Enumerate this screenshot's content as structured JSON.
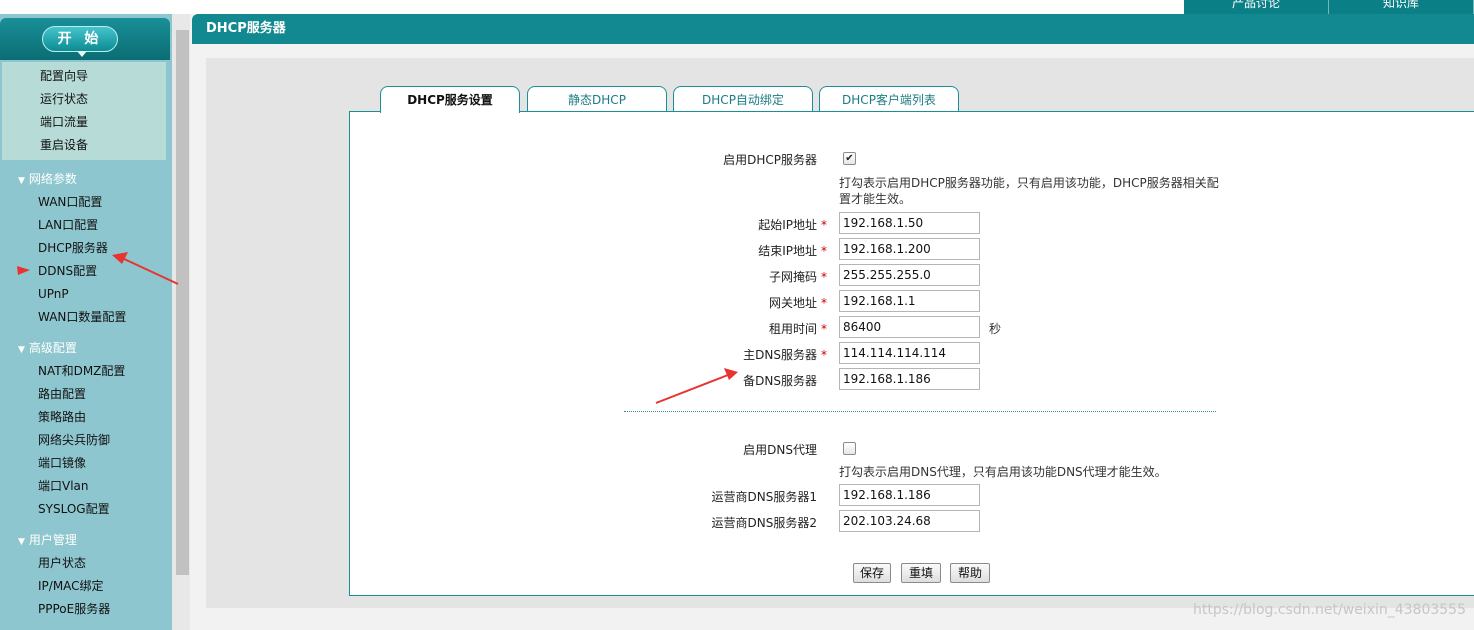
{
  "nav": {
    "start_label": "开 始",
    "quick_items": [
      "配置向导",
      "运行状态",
      "端口流量",
      "重启设备"
    ],
    "groups": [
      {
        "title": "网络参数",
        "items": [
          "WAN口配置",
          "LAN口配置",
          "DHCP服务器",
          "DDNS配置",
          "UPnP",
          "WAN口数量配置"
        ]
      },
      {
        "title": "高级配置",
        "items": [
          "NAT和DMZ配置",
          "路由配置",
          "策略路由",
          "网络尖兵防御",
          "端口镜像",
          "端口Vlan",
          "SYSLOG配置"
        ]
      },
      {
        "title": "用户管理",
        "items": [
          "用户状态",
          "IP/MAC绑定",
          "PPPoE服务器"
        ]
      }
    ]
  },
  "page_title": "DHCP服务器",
  "tabs": [
    "DHCP服务设置",
    "静态DHCP",
    "DHCP自动绑定",
    "DHCP客户端列表"
  ],
  "form": {
    "enable_dhcp_label": "启用DHCP服务器",
    "enable_dhcp_checked": true,
    "enable_dhcp_hint": "打勾表示启用DHCP服务器功能，只有启用该功能，DHCP服务器相关配置才能生效。",
    "fields": [
      {
        "label": "起始IP地址",
        "required": true,
        "value": "192.168.1.50"
      },
      {
        "label": "结束IP地址",
        "required": true,
        "value": "192.168.1.200"
      },
      {
        "label": "子网掩码",
        "required": true,
        "value": "255.255.255.0"
      },
      {
        "label": "网关地址",
        "required": true,
        "value": "192.168.1.1"
      },
      {
        "label": "租用时间",
        "required": true,
        "value": "86400",
        "unit": "秒"
      },
      {
        "label": "主DNS服务器",
        "required": true,
        "value": "114.114.114.114"
      },
      {
        "label": "备DNS服务器",
        "required": false,
        "value": "192.168.1.186"
      }
    ],
    "required_mark": "*",
    "enable_dns_proxy_label": "启用DNS代理",
    "enable_dns_proxy_checked": false,
    "enable_dns_proxy_hint": "打勾表示启用DNS代理，只有启用该功能DNS代理才能生效。",
    "isp_fields": [
      {
        "label": "运营商DNS服务器1",
        "value": "192.168.1.186"
      },
      {
        "label": "运营商DNS服务器2",
        "value": "202.103.24.68"
      }
    ]
  },
  "buttons": {
    "save": "保存",
    "reset": "重填",
    "help": "帮助"
  },
  "colors": {
    "accent": "#128990",
    "sidebar": "#8ec6cf",
    "annotation": "#e8332f",
    "required": "#cc0000"
  },
  "watermark": "https://blog.csdn.net/weixin_43803555"
}
